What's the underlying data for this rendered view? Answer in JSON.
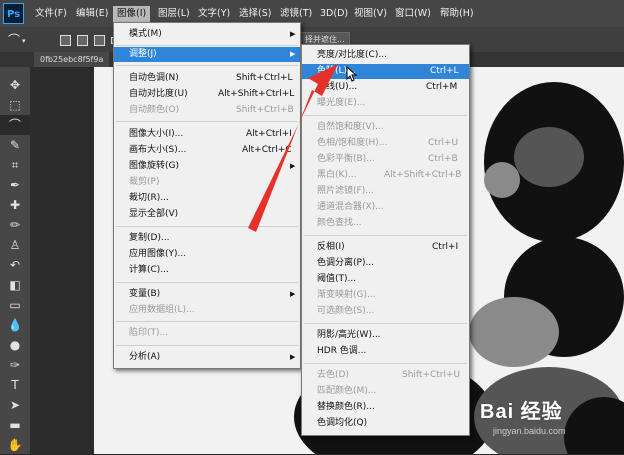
{
  "app": {
    "logo": "Ps"
  },
  "menubar": {
    "items": [
      "文件(F)",
      "编辑(E)",
      "图像(I)",
      "图层(L)",
      "文字(Y)",
      "选择(S)",
      "滤镜(T)",
      "3D(D)",
      "视图(V)",
      "窗口(W)",
      "帮助(H)"
    ],
    "active_index": 2
  },
  "options": {
    "button_label": "择并遮住..."
  },
  "document": {
    "tab_label": "0fb25ebc8f5f9a"
  },
  "image_menu": {
    "items": [
      {
        "label": "模式(M)",
        "shortcut": "",
        "enabled": true,
        "submenu": true
      },
      {
        "label": "调整(J)",
        "shortcut": "",
        "enabled": true,
        "submenu": true,
        "highlighted": true
      },
      {
        "label": "自动色调(N)",
        "shortcut": "Shift+Ctrl+L",
        "enabled": true
      },
      {
        "label": "自动对比度(U)",
        "shortcut": "Alt+Shift+Ctrl+L",
        "enabled": true
      },
      {
        "label": "自动颜色(O)",
        "shortcut": "Shift+Ctrl+B",
        "enabled": false
      },
      {
        "label": "图像大小(I)...",
        "shortcut": "Alt+Ctrl+I",
        "enabled": true
      },
      {
        "label": "画布大小(S)...",
        "shortcut": "Alt+Ctrl+C",
        "enabled": true
      },
      {
        "label": "图像旋转(G)",
        "shortcut": "",
        "enabled": true,
        "submenu": true
      },
      {
        "label": "裁剪(P)",
        "shortcut": "",
        "enabled": false
      },
      {
        "label": "裁切(R)...",
        "shortcut": "",
        "enabled": true
      },
      {
        "label": "显示全部(V)",
        "shortcut": "",
        "enabled": true
      },
      {
        "label": "复制(D)...",
        "shortcut": "",
        "enabled": true
      },
      {
        "label": "应用图像(Y)...",
        "shortcut": "",
        "enabled": true
      },
      {
        "label": "计算(C)...",
        "shortcut": "",
        "enabled": true
      },
      {
        "label": "变量(B)",
        "shortcut": "",
        "enabled": true,
        "submenu": true
      },
      {
        "label": "应用数据组(L)...",
        "shortcut": "",
        "enabled": false
      },
      {
        "label": "陷印(T)...",
        "shortcut": "",
        "enabled": false
      },
      {
        "label": "分析(A)",
        "shortcut": "",
        "enabled": true,
        "submenu": true
      }
    ]
  },
  "adjust_menu": {
    "items": [
      {
        "label": "亮度/对比度(C)...",
        "shortcut": "",
        "enabled": true
      },
      {
        "label": "色阶(L)...",
        "shortcut": "Ctrl+L",
        "enabled": true,
        "highlighted": true
      },
      {
        "label": "曲线(U)...",
        "shortcut": "Ctrl+M",
        "enabled": true
      },
      {
        "label": "曝光度(E)...",
        "shortcut": "",
        "enabled": false
      },
      {
        "label": "自然饱和度(V)...",
        "shortcut": "",
        "enabled": false
      },
      {
        "label": "色相/饱和度(H)...",
        "shortcut": "Ctrl+U",
        "enabled": false
      },
      {
        "label": "色彩平衡(B)...",
        "shortcut": "Ctrl+B",
        "enabled": false
      },
      {
        "label": "黑白(K)...",
        "shortcut": "Alt+Shift+Ctrl+B",
        "enabled": false
      },
      {
        "label": "照片滤镜(F)...",
        "shortcut": "",
        "enabled": false
      },
      {
        "label": "通道混合器(X)...",
        "shortcut": "",
        "enabled": false
      },
      {
        "label": "颜色查找...",
        "shortcut": "",
        "enabled": false
      },
      {
        "label": "反相(I)",
        "shortcut": "Ctrl+I",
        "enabled": true
      },
      {
        "label": "色调分离(P)...",
        "shortcut": "",
        "enabled": true
      },
      {
        "label": "阈值(T)...",
        "shortcut": "",
        "enabled": true
      },
      {
        "label": "渐变映射(G)...",
        "shortcut": "",
        "enabled": false
      },
      {
        "label": "可选颜色(S)...",
        "shortcut": "",
        "enabled": false
      },
      {
        "label": "阴影/高光(W)...",
        "shortcut": "",
        "enabled": true
      },
      {
        "label": "HDR 色调...",
        "shortcut": "",
        "enabled": true
      },
      {
        "label": "去色(D)",
        "shortcut": "Shift+Ctrl+U",
        "enabled": false
      },
      {
        "label": "匹配颜色(M)...",
        "shortcut": "",
        "enabled": false
      },
      {
        "label": "替换颜色(R)...",
        "shortcut": "",
        "enabled": true
      },
      {
        "label": "色调均化(Q)",
        "shortcut": "",
        "enabled": true
      }
    ]
  },
  "watermark": {
    "text": "Bai 经验",
    "sub": "jingyan.baidu.com"
  },
  "colors": {
    "highlight": "#2f86d8",
    "arrow": "#e8302a",
    "menu_bg": "#f0f0f0"
  }
}
